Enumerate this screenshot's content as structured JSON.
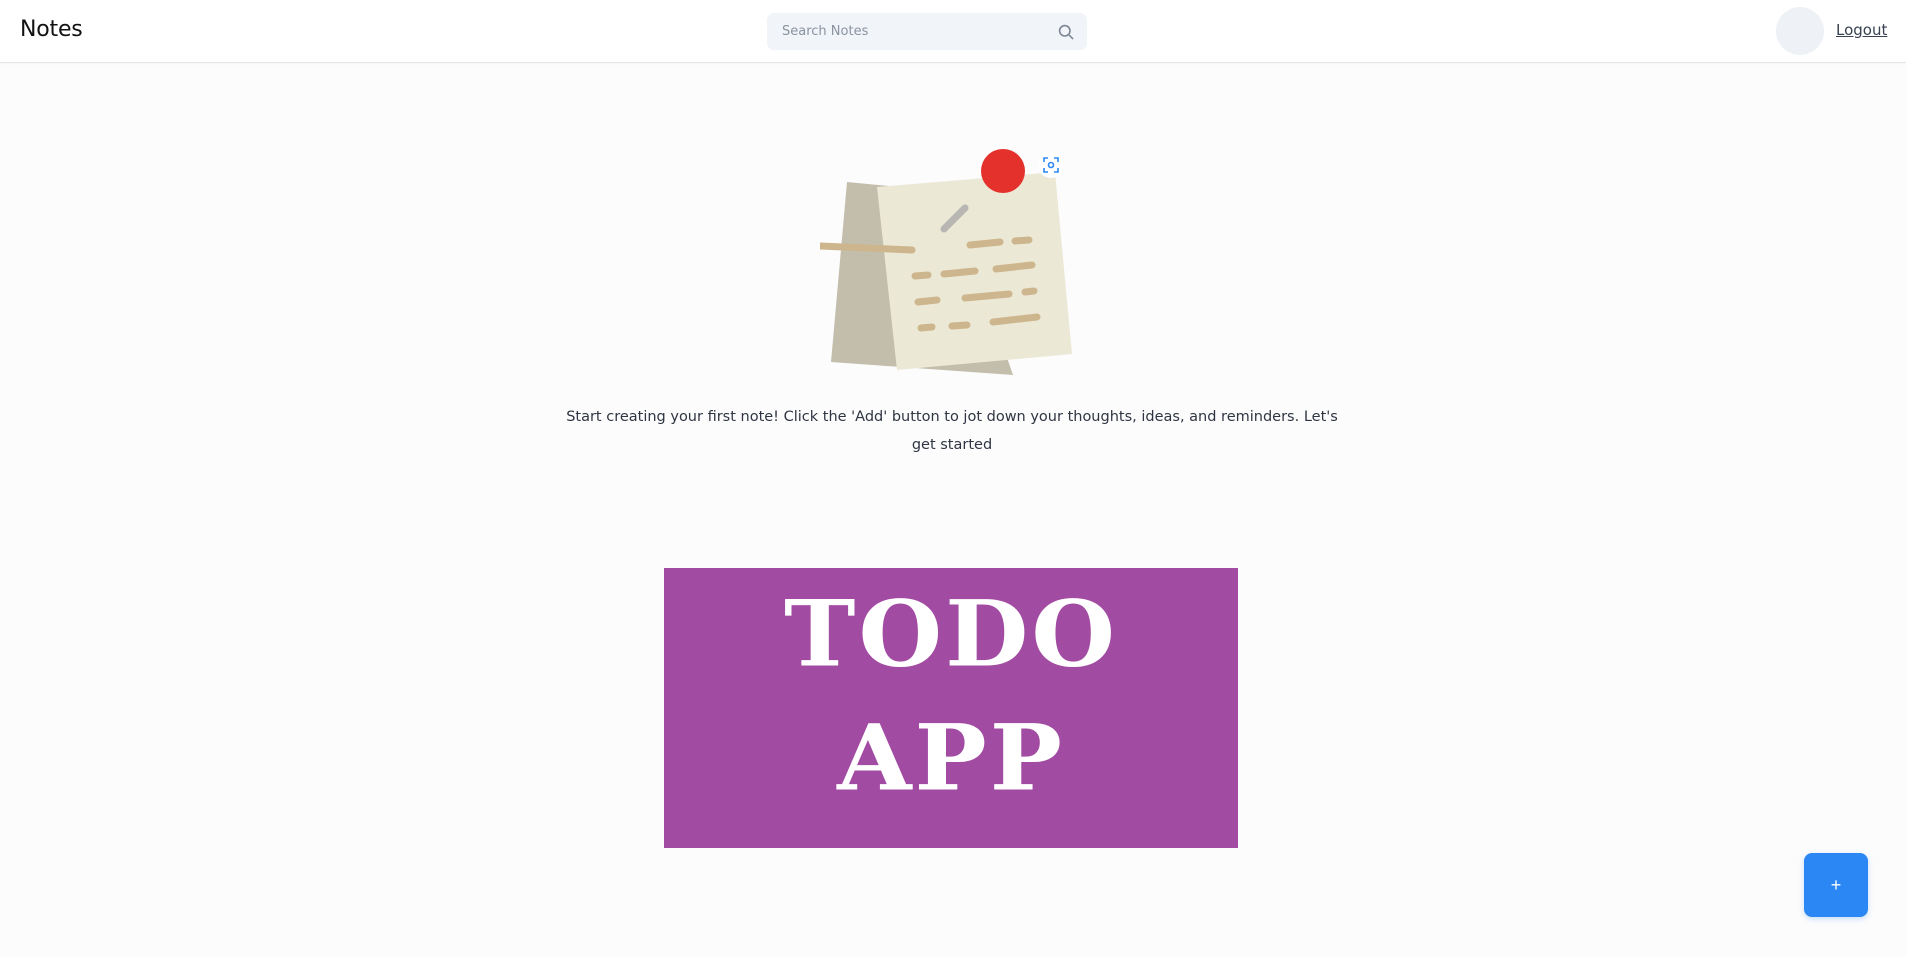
{
  "app": {
    "title": "Notes"
  },
  "search": {
    "placeholder": "Search Notes",
    "value": "",
    "icon": "search-icon"
  },
  "header": {
    "logout_label": "Logout",
    "avatar_icon": "avatar"
  },
  "empty_state": {
    "message": "Start creating your first note! Click the 'Add' button to jot down your thoughts, ideas, and reminders. Let's get started",
    "illustration_icon": "sticky-note-icon"
  },
  "banner": {
    "line1": "TODO",
    "line2": "APP",
    "background": "#a24ba2"
  },
  "fab": {
    "label": "+",
    "color": "#2b87f3"
  },
  "colors": {
    "accent": "#2b87f3",
    "pin": "#e4312b",
    "note": "#ece8d6",
    "note_back": "#c3beab",
    "note_lines": "#cdb68d"
  }
}
